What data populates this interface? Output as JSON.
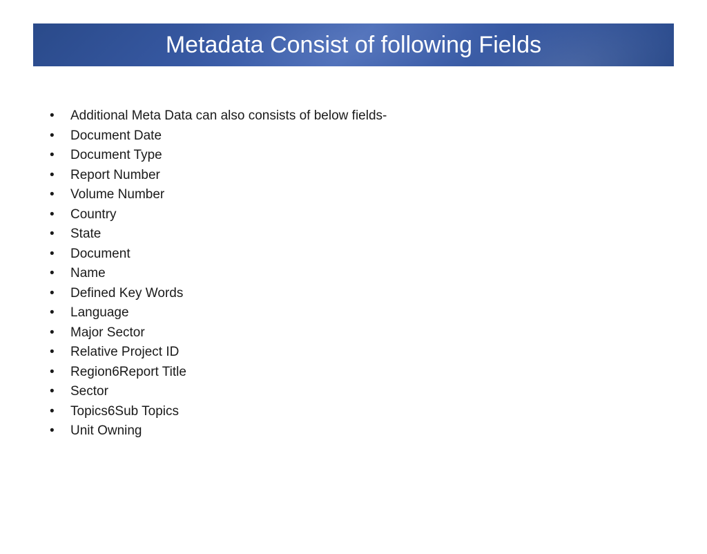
{
  "title": "Metadata Consist of following Fields",
  "bullets": [
    "Additional Meta Data can also consists of below fields-",
    "Document Date",
    "Document Type",
    "Report Number",
    "Volume Number",
    "Country",
    "State",
    "Document",
    "Name",
    "Defined Key Words",
    "Language",
    "Major Sector",
    "Relative Project ID",
    "Region6Report Title",
    "Sector",
    "Topics6Sub Topics",
    "Unit Owning"
  ]
}
